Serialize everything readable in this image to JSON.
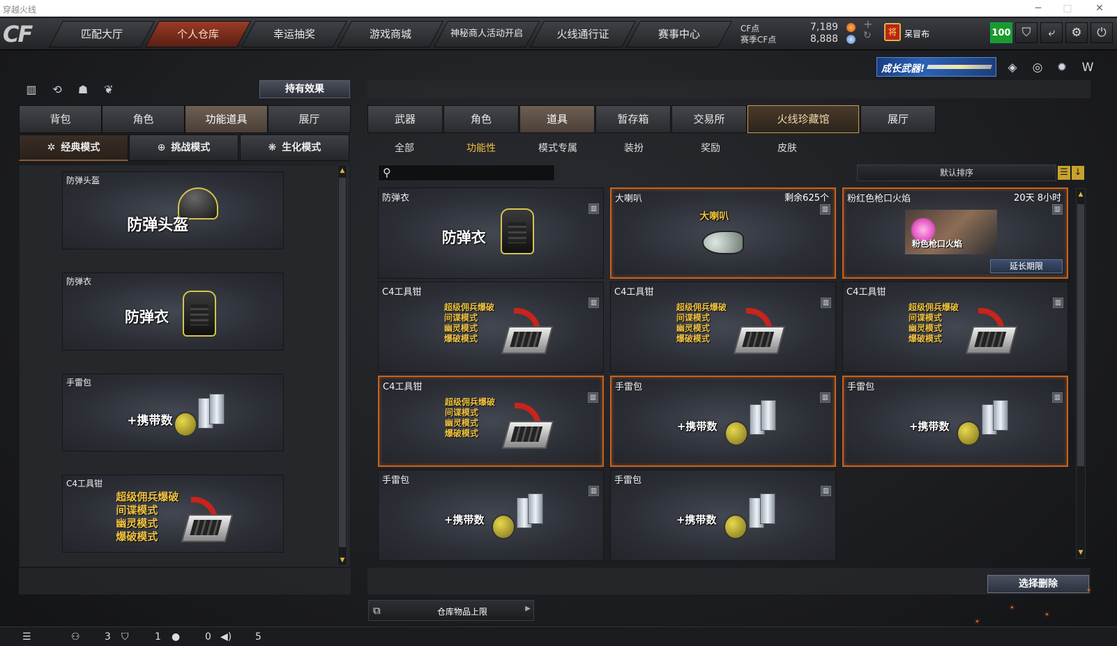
{
  "window": {
    "title": "穿越火线"
  },
  "nav": {
    "tabs": [
      "匹配大厅",
      "个人仓库",
      "幸运抽奖",
      "游戏商城",
      "神秘商人活动开启",
      "火线通行证",
      "赛事中心"
    ],
    "active_index": 1
  },
  "currency": {
    "cf_label": "CF点",
    "cf_value": "7,189",
    "season_label": "赛季CF点",
    "season_value": "8,888"
  },
  "user": {
    "rank_icon": "rank-badge-icon",
    "name": "呆冒布",
    "level": "100"
  },
  "toolbar_icons": [
    "shield-icon",
    "exit-icon",
    "gear-icon",
    "power-icon"
  ],
  "banner": {
    "text": "成长武器!"
  },
  "left": {
    "effect_button": "持有效果",
    "tabs": [
      "背包",
      "角色",
      "功能道具",
      "展厅"
    ],
    "active_tab": 2,
    "modes": [
      "经典模式",
      "挑战模式",
      "生化模式"
    ],
    "active_mode": 0,
    "items": [
      {
        "name": "防弹头盔",
        "label": "防弹头盔"
      },
      {
        "name": "防弹衣",
        "label": "防弹衣"
      },
      {
        "name": "手雷包",
        "label": "+携带数"
      },
      {
        "name": "C4工具钳",
        "lines": [
          "超级佣兵爆破",
          "间谍模式",
          "幽灵模式",
          "爆破模式"
        ]
      }
    ]
  },
  "right": {
    "tabs": [
      "武器",
      "角色",
      "道具",
      "暂存箱",
      "交易所",
      "火线珍藏馆",
      "展厅"
    ],
    "active_tab": 2,
    "special_tab": 5,
    "subtabs": [
      "全部",
      "功能性",
      "模式专属",
      "装扮",
      "奖励",
      "皮肤"
    ],
    "active_subtab": 1,
    "search": {
      "value": "",
      "placeholder": ""
    },
    "sort_label": "默认排序",
    "items": [
      {
        "name": "防弹衣",
        "type": "vest",
        "label": "防弹衣",
        "selected": false
      },
      {
        "name": "大喇叭",
        "type": "horn",
        "label": "大喇叭",
        "remain": "剩余625个",
        "selected": true
      },
      {
        "name": "粉红色枪口火焰",
        "type": "flame",
        "label": "粉色枪口火焰",
        "remain": "20天 8小时",
        "extend": "延长期限",
        "selected": true
      },
      {
        "name": "C4工具钳",
        "type": "c4",
        "lines": [
          "超级佣兵爆破",
          "间谍模式",
          "幽灵模式",
          "爆破模式"
        ],
        "selected": false
      },
      {
        "name": "C4工具钳",
        "type": "c4",
        "lines": [
          "超级佣兵爆破",
          "间谍模式",
          "幽灵模式",
          "爆破模式"
        ],
        "selected": false
      },
      {
        "name": "C4工具钳",
        "type": "c4",
        "lines": [
          "超级佣兵爆破",
          "间谍模式",
          "幽灵模式",
          "爆破模式"
        ],
        "selected": false
      },
      {
        "name": "C4工具钳",
        "type": "c4",
        "lines": [
          "超级佣兵爆破",
          "间谍模式",
          "幽灵模式",
          "爆破模式"
        ],
        "selected": true
      },
      {
        "name": "手雷包",
        "type": "grenade",
        "label": "+携带数",
        "selected": true
      },
      {
        "name": "手雷包",
        "type": "grenade",
        "label": "+携带数",
        "selected": true
      },
      {
        "name": "手雷包",
        "type": "grenade",
        "label": "+携带数",
        "selected": false
      },
      {
        "name": "手雷包",
        "type": "grenade",
        "label": "+携带数",
        "selected": false
      }
    ],
    "delete_button": "选择删除",
    "capacity_label": "仓库物品上限"
  },
  "status": {
    "values": [
      "3",
      "1",
      "0",
      "5"
    ]
  },
  "colors": {
    "accent": "#c8621c",
    "gold": "#f1c342",
    "level_green": "#1d9a2c"
  }
}
